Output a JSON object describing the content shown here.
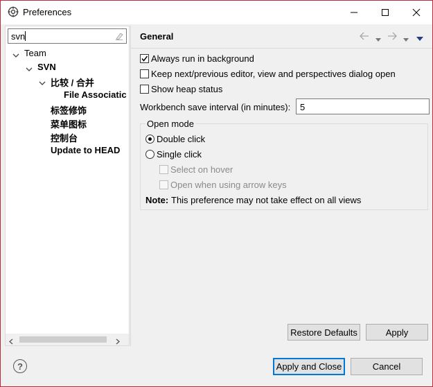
{
  "window": {
    "title": "Preferences"
  },
  "search": {
    "value": "svn"
  },
  "tree": {
    "team": "Team",
    "svn": "SVN",
    "compare": "比较 / 合并",
    "file_assoc": "File Associatic",
    "label_decor": "标签修饰",
    "menu_icons": "菜单图标",
    "console": "控制台",
    "update_head": "Update to HEAD"
  },
  "page": {
    "title": "General",
    "always_run": "Always run in background",
    "keep_next": "Keep next/previous editor, view and perspectives dialog open",
    "show_heap": "Show heap status",
    "save_interval_label": "Workbench save interval (in minutes):",
    "save_interval_value": "5",
    "open_mode": {
      "title": "Open mode",
      "double_click": "Double click",
      "single_click": "Single click",
      "select_hover": "Select on hover",
      "open_arrow": "Open when using arrow keys",
      "note_label": "Note:",
      "note_text": "This preference may not take effect on all views"
    }
  },
  "buttons": {
    "restore": "Restore Defaults",
    "apply": "Apply",
    "apply_close": "Apply and Close",
    "cancel": "Cancel"
  }
}
